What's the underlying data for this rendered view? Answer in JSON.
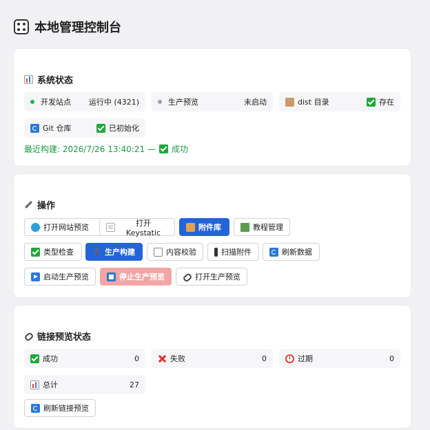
{
  "page": {
    "title": "本地管理控制台",
    "icon": "control-panel-icon"
  },
  "system": {
    "title": "系统状态",
    "title_icon": "bar-chart-icon",
    "items": [
      {
        "label": "开发站点",
        "value": "运行中 (4321)",
        "indicator": "green-dot"
      },
      {
        "label": "生产预览",
        "value": "未启动",
        "indicator": "gray-dot"
      },
      {
        "label": "dist 目录",
        "value": "存在",
        "indicator": "package-icon"
      },
      {
        "label": "Git 仓库",
        "value": "已初始化",
        "indicator": "refresh-icon"
      }
    ],
    "last_build": "最近构建: 2026/7/26 13:40:21 —",
    "last_build_result": "成功"
  },
  "actions": {
    "title": "操作",
    "title_icon": "wrench-icon",
    "buttons": [
      {
        "label": "打开网站预览",
        "icon": "globe-icon"
      },
      {
        "label": "打开 Keystatic",
        "icon": "memo-icon"
      },
      {
        "label": "附件库",
        "icon": "folder-icon"
      },
      {
        "label": "教程管理",
        "icon": "book-icon"
      },
      {
        "label": "类型检查",
        "icon": "check-icon"
      },
      {
        "label": "生产构建",
        "icon": "hammer-icon"
      },
      {
        "label": "内容校验",
        "icon": "clipboard-icon"
      },
      {
        "label": "扫描附件",
        "icon": "scanner-icon"
      },
      {
        "label": "刷新数据",
        "icon": "refresh-icon"
      },
      {
        "label": "启动生产预览",
        "icon": "play-icon"
      },
      {
        "label": "停止生产预览",
        "icon": "stop-icon"
      },
      {
        "label": "打开生产预览",
        "icon": "link-icon"
      }
    ]
  },
  "links": {
    "title": "链接预览状态",
    "title_icon": "link-icon",
    "items": [
      {
        "label": "成功",
        "value": "0",
        "icon": "check-icon"
      },
      {
        "label": "失败",
        "value": "0",
        "icon": "cross-icon"
      },
      {
        "label": "过期",
        "value": "0",
        "icon": "alarm-clock-icon"
      },
      {
        "label": "总计",
        "value": "27",
        "icon": "bar-chart-icon"
      }
    ],
    "refresh_label": "刷新链接预览"
  },
  "colors": {
    "primary": "#2364d9",
    "danger_disabled": "#f2a6a6",
    "success_text": "#1a9a44"
  }
}
